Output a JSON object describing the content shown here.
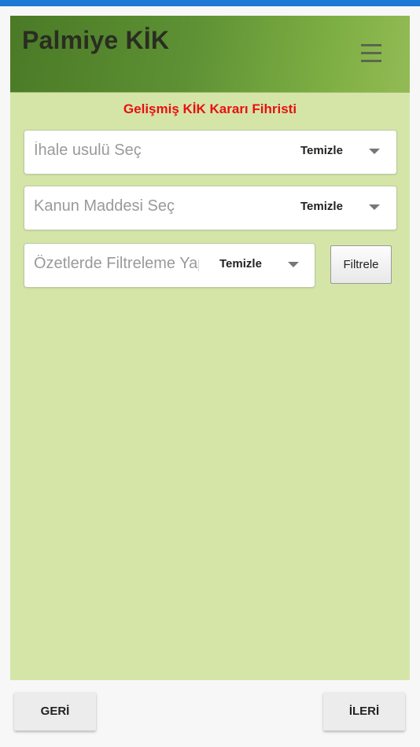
{
  "header": {
    "title": "Palmiye KİK",
    "menu_icon": "hamburger-menu-icon"
  },
  "subtitle": "Gelişmiş KİK Kararı Fihristi",
  "filters": [
    {
      "placeholder": "İhale usulü Seç",
      "clear_label": "Temizle"
    },
    {
      "placeholder": "Kanun Maddesi Seç",
      "clear_label": "Temizle"
    },
    {
      "placeholder": "Özetlerde Filtreleme Yapın",
      "clear_label": "Temizle"
    }
  ],
  "filter_button": "Filtrele",
  "nav": {
    "back": "GERİ",
    "next": "İLERİ"
  },
  "colors": {
    "status_bar": "#1e78d6",
    "header_start": "#4a7a26",
    "header_end": "#93bb55",
    "background": "#d5e5a8",
    "subtitle": "#e81010"
  }
}
